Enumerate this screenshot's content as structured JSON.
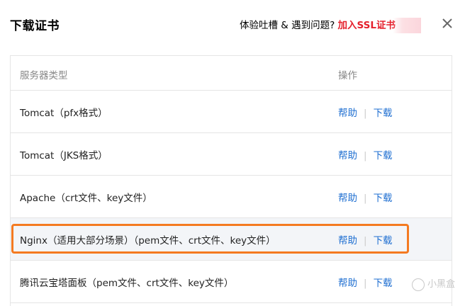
{
  "dialog": {
    "title": "下载证书",
    "feedback_text": "体验吐槽 & 遇到问题?",
    "join_link": "加入SSL证书",
    "close_icon": "close-icon"
  },
  "table": {
    "headers": {
      "type": "服务器类型",
      "operation": "操作"
    },
    "rows": [
      {
        "type": "Tomcat（pfx格式）",
        "help": "帮助",
        "download": "下载"
      },
      {
        "type": "Tomcat（JKS格式）",
        "help": "帮助",
        "download": "下载"
      },
      {
        "type": "Apache（crt文件、key文件）",
        "help": "帮助",
        "download": "下载"
      },
      {
        "type": "Nginx（适用大部分场景）（pem文件、crt文件、key文件）",
        "help": "帮助",
        "download": "下载",
        "highlighted": true
      },
      {
        "type": "腾讯云宝塔面板（pem文件、crt文件、key文件）",
        "help": "帮助",
        "download": "下载"
      }
    ]
  },
  "colors": {
    "link": "#1f6fd1",
    "join_link": "#e5202c",
    "highlight_border": "#f47a21",
    "row_highlight_bg": "#f3f5f8"
  },
  "watermark": {
    "text": "小黑盒"
  }
}
